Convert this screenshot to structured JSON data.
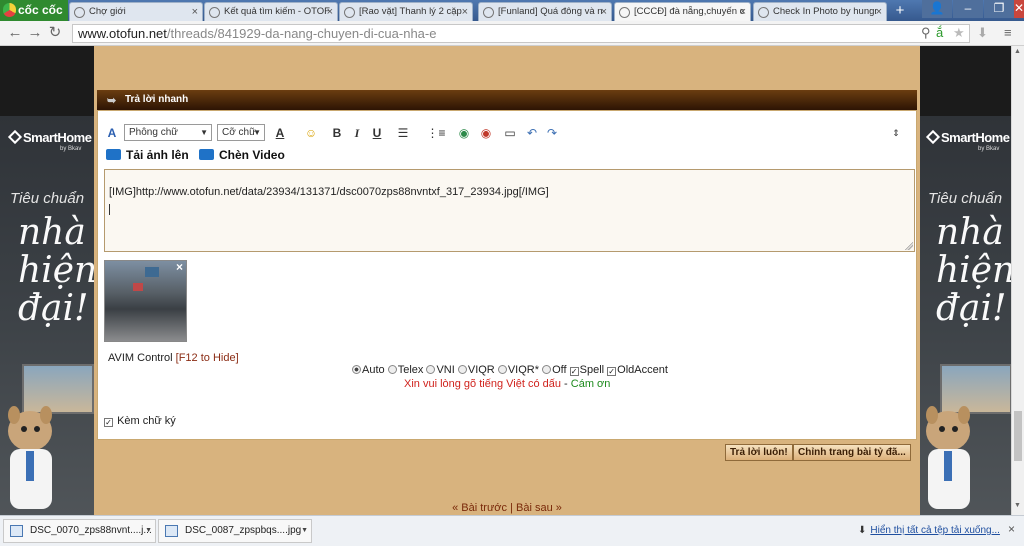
{
  "browser": {
    "brand": "cốc cốc",
    "tabs": [
      {
        "title": "Chợ giới"
      },
      {
        "title": "Kết quả tìm kiếm - OTOF"
      },
      {
        "title": "[Rao vặt] Thanh lý 2 cặp"
      },
      {
        "title": "[Funland] Quá đông và n"
      },
      {
        "title": "[CCCĐ] đà nẵng,chuyến c"
      },
      {
        "title": "Check In Photo by hungr"
      }
    ],
    "url_host": "www.otofun.net",
    "url_path": "/threads/841929-da-nang-chuyen-di-cua-nha-e"
  },
  "ads": {
    "logo": "SmartHome",
    "by": "by Bkav",
    "tagline_1": "Tiêu chuẩn",
    "tagline_2": "nhà hiện đại!"
  },
  "quick_reply": {
    "header": "Trả lời nhanh",
    "font_select": "Phông chữ",
    "size_select": "Cỡ chữ",
    "upload_image": "Tải ảnh lên",
    "insert_video": "Chèn Video",
    "editor_text": "[IMG]http://www.otofun.net/data/23934/131371/dsc0070zps88nvntxf_317_23934.jpg[/IMG]",
    "avim_label": "AVIM Control",
    "avim_hide": "[F12 to Hide]",
    "avim_modes": [
      "Auto",
      "Telex",
      "VNI",
      "VIQR",
      "VIQR*",
      "Off"
    ],
    "avim_selected": "Auto",
    "spell": "Spell",
    "old_accent": "OldAccent",
    "msg_red": "Xin vui lòng gõ tiếng Việt có dấu",
    "msg_sep": "-",
    "msg_green": "Cám ơn",
    "signature": "Kèm chữ ký",
    "submit": "Trả lời luôn!",
    "advanced": "Chỉnh trang bài tỷ đã..."
  },
  "pager": {
    "prev": "« Bài trước",
    "sep": "|",
    "next": "Bài sau »"
  },
  "downloads": {
    "items": [
      {
        "name": "DSC_0070_zps88nvnt....j..."
      },
      {
        "name": "DSC_0087_zpspbqs....jpg"
      }
    ],
    "show_all": "Hiển thị tất cả tệp tải xuống..."
  }
}
